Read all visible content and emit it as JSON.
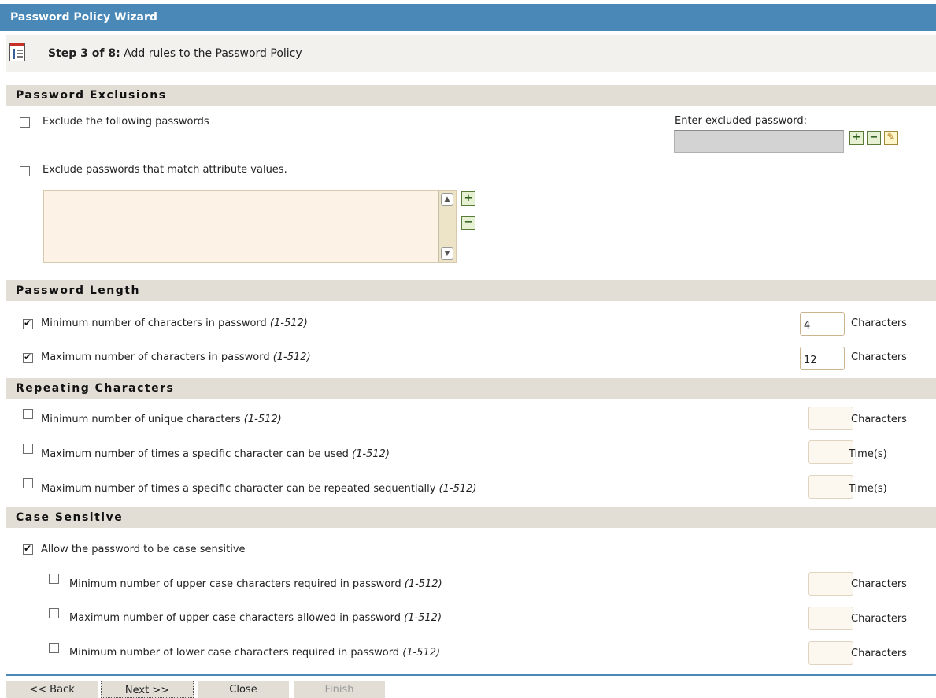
{
  "window_title": "Password Policy Wizard",
  "step": {
    "prefix": "Step 3 of 8:",
    "text": " Add rules to the Password Policy"
  },
  "exclusions": {
    "header": "Password Exclusions",
    "exclude_following_label": "Exclude the following passwords",
    "excluded_password_label": "Enter excluded password:",
    "excluded_password_value": "",
    "exclude_attribute_label": "Exclude passwords that match attribute values.",
    "attribute_list": []
  },
  "length": {
    "header": "Password Length",
    "min_label": "Minimum number of characters in password ",
    "min_range": "(1-512)",
    "min_value": "4",
    "min_unit": "Characters",
    "max_label": "Maximum number of characters in password ",
    "max_range": "(1-512)",
    "max_value": "12",
    "max_unit": "Characters"
  },
  "repeating": {
    "header": "Repeating Characters",
    "unique_label": "Minimum number of unique characters ",
    "unique_range": "(1-512)",
    "unique_unit": "Characters",
    "times_used_label": "Maximum number of times a specific character can be used ",
    "times_used_range": "(1-512)",
    "times_used_unit": "Time(s)",
    "sequential_label": "Maximum number of times a specific character can be repeated sequentially ",
    "sequential_range": "(1-512)",
    "sequential_unit": "Time(s)"
  },
  "case": {
    "header": "Case Sensitive",
    "allow_label": "Allow the password to be case sensitive",
    "min_upper_label": "Minimum number of upper case characters required in password ",
    "min_upper_range": "(1-512)",
    "min_upper_unit": "Characters",
    "max_upper_label": "Maximum number of upper case characters allowed in password ",
    "max_upper_range": "(1-512)",
    "max_upper_unit": "Characters",
    "min_lower_label": "Minimum number of lower case characters required in password ",
    "min_lower_range": "(1-512)",
    "min_lower_unit": "Characters"
  },
  "buttons": {
    "back": "<< Back",
    "next": "Next >>",
    "close": "Close",
    "finish": "Finish"
  },
  "colors": {
    "title_bar": "#4a88b8",
    "section_bg": "#e2ddd5"
  }
}
